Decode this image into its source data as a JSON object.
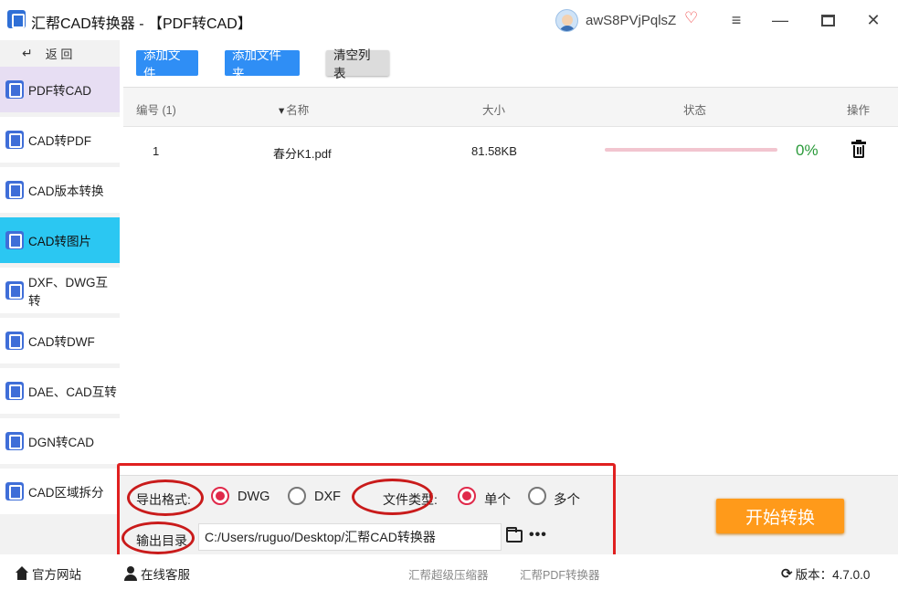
{
  "window": {
    "title": "汇帮CAD转换器 - 【PDF转CAD】",
    "username": "awS8PVjPqlsZ",
    "menu_glyph": "≡",
    "minimize_glyph": "—",
    "close_glyph": "✕",
    "vip_glyph": "♡"
  },
  "sidebar": {
    "back_glyph": "↵",
    "back_label": "返 回",
    "items": [
      {
        "label": "PDF转CAD",
        "icon": "pdf-to-cad-icon"
      },
      {
        "label": "CAD转PDF",
        "icon": "cad-to-pdf-icon"
      },
      {
        "label": "CAD版本转换",
        "icon": "cad-version-icon"
      },
      {
        "label": "CAD转图片",
        "icon": "cad-to-image-icon"
      },
      {
        "label": "DXF、DWG互转",
        "icon": "dxf-dwg-icon"
      },
      {
        "label": "CAD转DWF",
        "icon": "cad-to-dwf-icon"
      },
      {
        "label": "DAE、CAD互转",
        "icon": "dae-cad-icon"
      },
      {
        "label": "DGN转CAD",
        "icon": "dgn-to-cad-icon"
      },
      {
        "label": "CAD区域拆分",
        "icon": "cad-split-icon"
      }
    ]
  },
  "toolbar": {
    "add_file": "添加文件",
    "add_folder": "添加文件夹",
    "clear_list": "清空列表"
  },
  "table": {
    "headers": {
      "num": "编号 (1)",
      "name": "名称",
      "sort_glyph": "▾",
      "size": "大小",
      "status": "状态",
      "action": "操作"
    },
    "rows": [
      {
        "num": "1",
        "name": "春分K1.pdf",
        "size": "81.58KB",
        "progress": 0,
        "percent": "0%"
      }
    ]
  },
  "settings": {
    "format_label": "导出格式:",
    "format_options": [
      "DWG",
      "DXF"
    ],
    "format_selected": "DWG",
    "type_label": "文件类型:",
    "type_options": [
      "单个",
      "多个"
    ],
    "type_selected": "单个",
    "output_label": "输出目录",
    "output_path": "C:/Users/ruguo/Desktop/汇帮CAD转换器",
    "more_glyph": "•••",
    "start_button": "开始转换"
  },
  "footer": {
    "home": "官方网站",
    "service": "在线客服",
    "compressor": "汇帮超级压缩器",
    "pdf_converter": "汇帮PDF转换器",
    "refresh_glyph": "⟳",
    "version": "版本：4.7.0.0"
  },
  "colors": {
    "accent_blue": "#2f8ef5",
    "selected_item": "#2bc7f2",
    "start_orange": "#ff9a1a",
    "radio_red": "#e0294a",
    "annotation_red": "#e02020",
    "progress_green": "#2a9a3a"
  }
}
